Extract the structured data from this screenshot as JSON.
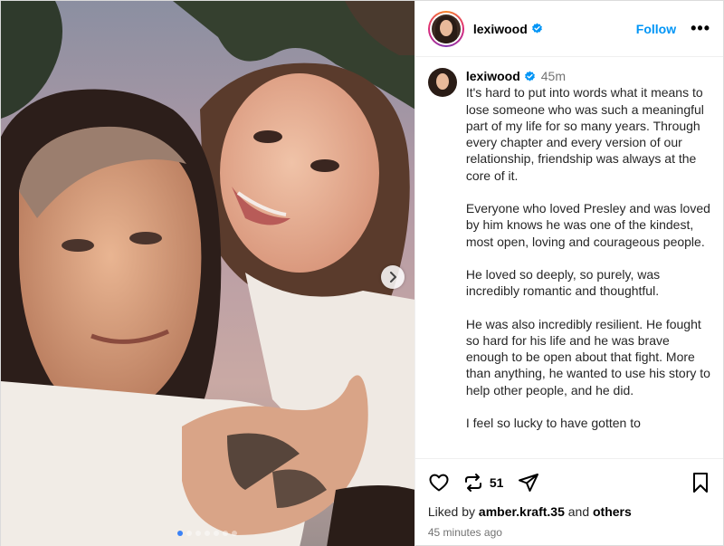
{
  "post": {
    "username": "lexiwood",
    "follow_label": "Follow",
    "more_label": "•••",
    "caption": {
      "username": "lexiwood",
      "time": "45m",
      "paragraphs": [
        "It's hard to put into words what it means to lose someone who was such a meaningful part of my life for so many years. Through every chapter and every version of our relationship, friendship was always at the core of it.",
        "Everyone who loved Presley and was loved by him knows he was one of the kindest, most open, loving and courageous people.",
        "He loved so deeply, so purely, was incredibly romantic and thoughtful.",
        "He was also incredibly resilient. He fought so hard for his life and he was brave enough to be open about that fight. More than anything, he wanted to use his story to help other people, and he did.",
        "I feel so lucky to have gotten to"
      ]
    },
    "reposts": "51",
    "liked_prefix": "Liked by",
    "liked_user": "amber.kraft.35",
    "liked_and": "and",
    "liked_others": "others",
    "time_ago": "45 minutes ago"
  },
  "carousel": {
    "total_slides": 7,
    "active_slide": 1
  },
  "colors": {
    "link_blue": "#0095f6",
    "verified_blue": "#0095f6",
    "muted": "#737373"
  },
  "icons": [
    "heart-icon",
    "repost-icon",
    "share-icon",
    "bookmark-icon",
    "chevron-right-icon",
    "verified-icon",
    "more-icon"
  ]
}
